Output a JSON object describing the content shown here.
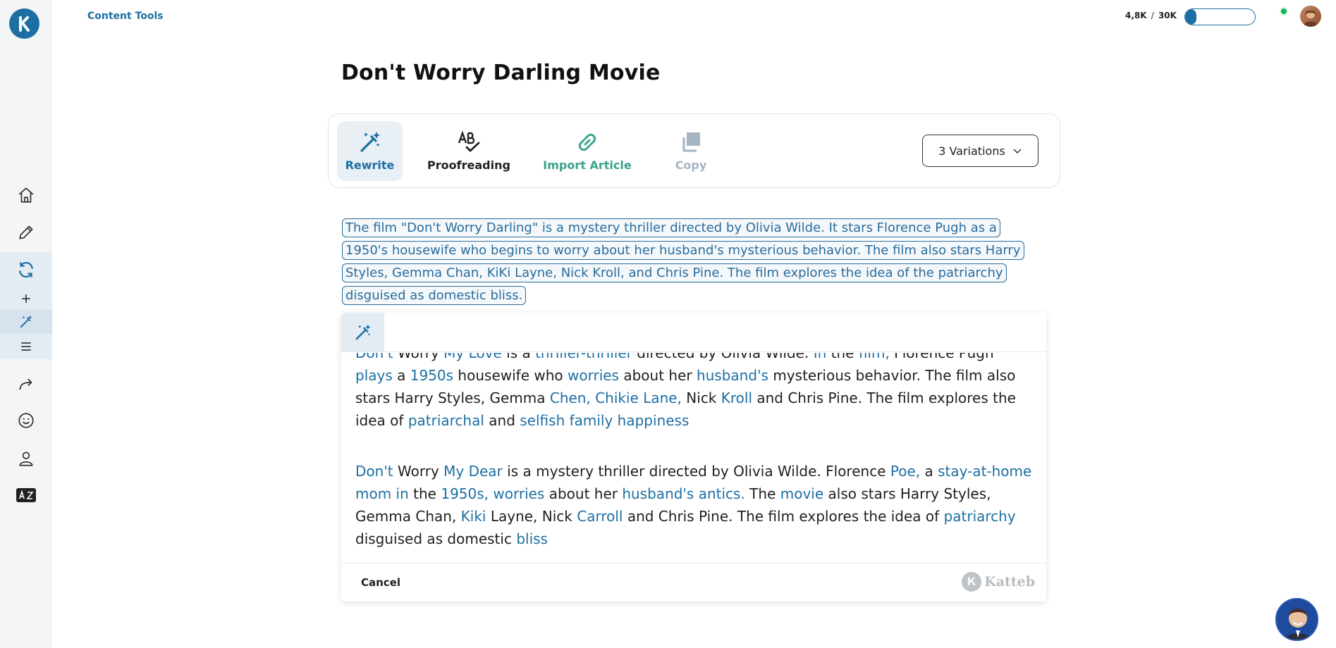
{
  "header": {
    "section_link": "Content Tools",
    "usage_used": "4,8K",
    "usage_sep": "/",
    "usage_total": "30K",
    "usage_fraction": 0.16
  },
  "page": {
    "title": "Don't Worry Darling Movie"
  },
  "toolbar": {
    "rewrite_label": "Rewrite",
    "proofreading_label": "Proofreading",
    "import_label": "Import Article",
    "copy_label": "Copy",
    "variations_label": "3 Variations"
  },
  "source": {
    "text": "The film \"Don't Worry Darling\" is a mystery thriller directed by Olivia Wilde. It stars Florence Pugh as a 1950's housewife who begins to worry about her husband's mysterious behavior. The film also stars Harry Styles, Gemma Chan, KiKi Layne, Nick Kroll, and Chris Pine. The film explores the idea of the patriarchy disguised as domestic bliss."
  },
  "variants": [
    {
      "segments": [
        {
          "t": "Don't",
          "c": true
        },
        {
          "t": " Worry ",
          "c": false
        },
        {
          "t": "My Love",
          "c": true
        },
        {
          "t": " is a ",
          "c": false
        },
        {
          "t": "thriller-thriller",
          "c": true
        },
        {
          "t": " directed by Olivia Wilde. ",
          "c": false
        },
        {
          "t": "In",
          "c": true
        },
        {
          "t": " the ",
          "c": false
        },
        {
          "t": "film,",
          "c": true
        },
        {
          "t": " Florence Pugh ",
          "c": false
        },
        {
          "t": "plays",
          "c": true
        },
        {
          "t": " a ",
          "c": false
        },
        {
          "t": "1950s",
          "c": true
        },
        {
          "t": " housewife who ",
          "c": false
        },
        {
          "t": "worries",
          "c": true
        },
        {
          "t": " about her ",
          "c": false
        },
        {
          "t": "husband's",
          "c": true
        },
        {
          "t": " mysterious behavior. The film also stars Harry Styles, Gemma ",
          "c": false
        },
        {
          "t": "Chen, Chikie Lane,",
          "c": true
        },
        {
          "t": " Nick ",
          "c": false
        },
        {
          "t": "Kroll",
          "c": true
        },
        {
          "t": " and Chris Pine. The film explores the idea of ",
          "c": false
        },
        {
          "t": "patriarchal",
          "c": true
        },
        {
          "t": " and ",
          "c": false
        },
        {
          "t": "selfish family happiness",
          "c": true
        }
      ]
    },
    {
      "segments": [
        {
          "t": "Don't",
          "c": true
        },
        {
          "t": " Worry ",
          "c": false
        },
        {
          "t": "My Dear",
          "c": true
        },
        {
          "t": " is a mystery thriller directed by Olivia Wilde. Florence ",
          "c": false
        },
        {
          "t": "Poe,",
          "c": true
        },
        {
          "t": " a ",
          "c": false
        },
        {
          "t": "stay-at-home mom in",
          "c": true
        },
        {
          "t": " the ",
          "c": false
        },
        {
          "t": "1950s, worries",
          "c": true
        },
        {
          "t": " about her ",
          "c": false
        },
        {
          "t": "husband's antics.",
          "c": true
        },
        {
          "t": " The ",
          "c": false
        },
        {
          "t": "movie",
          "c": true
        },
        {
          "t": " also stars Harry Styles, Gemma Chan, ",
          "c": false
        },
        {
          "t": "Kiki",
          "c": true
        },
        {
          "t": " Layne, Nick ",
          "c": false
        },
        {
          "t": "Carroll",
          "c": true
        },
        {
          "t": " and Chris Pine. The film explores the idea of ",
          "c": false
        },
        {
          "t": "patriarchy",
          "c": true
        },
        {
          "t": " disguised as domestic ",
          "c": false
        },
        {
          "t": "bliss",
          "c": true
        }
      ]
    }
  ],
  "panel": {
    "cancel_label": "Cancel",
    "brand_logo_text": "Katteb"
  },
  "colors": {
    "accent": "#1d6fa3",
    "import": "#3aa28e",
    "disabled": "#a6b4c4",
    "online": "#19b35a"
  }
}
